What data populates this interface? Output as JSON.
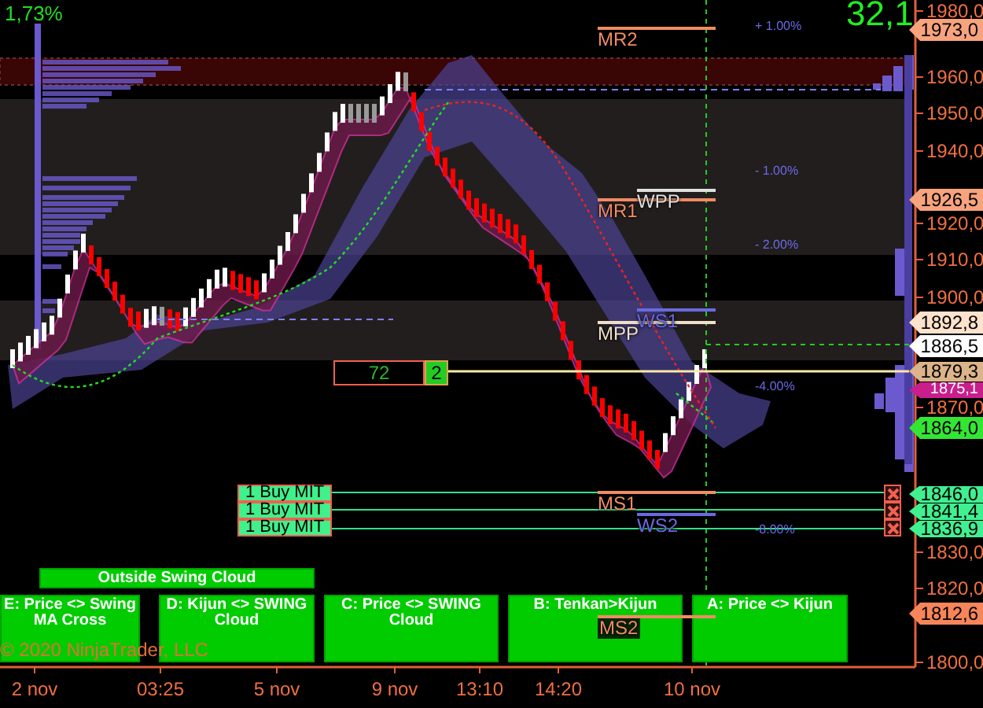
{
  "header": {
    "change_percent": "1,73%",
    "value": "32,1"
  },
  "price_axis": {
    "ticks": [
      "1980,0",
      "1960,0",
      "1950,0",
      "1940,0",
      "1920,0",
      "1910,0",
      "1900,0",
      "1870,0",
      "1830,0",
      "1820,0",
      "1800,0"
    ]
  },
  "price_markers": [
    {
      "label": "1973,0",
      "color": "#f7a37e"
    },
    {
      "label": "1926,5",
      "color": "#f7a37e"
    },
    {
      "label": "1892,8",
      "color": "#fde2cc"
    },
    {
      "label": "1886,5",
      "color": "#ffffff"
    },
    {
      "label": "1879,3",
      "color": "#dcb48a"
    },
    {
      "label": "1875,1",
      "color": "#c81f8c"
    },
    {
      "label": "1864,0",
      "color": "#33e633"
    },
    {
      "label": "1846,0",
      "color": "#40f090"
    },
    {
      "label": "1841,4",
      "color": "#40f090"
    },
    {
      "label": "1836,9",
      "color": "#40f090"
    },
    {
      "label": "1812,6",
      "color": "#f7855a"
    }
  ],
  "pivots": [
    {
      "label": "MR2",
      "color": "#f08c64"
    },
    {
      "label": "WPP",
      "color": "#e0e0e0"
    },
    {
      "label": "MR1",
      "color": "#f08c64"
    },
    {
      "label": "WS1",
      "color": "#6a6ae0"
    },
    {
      "label": "MPP",
      "color": "#f0e0c8"
    },
    {
      "label": "MS1",
      "color": "#f08c64"
    },
    {
      "label": "WS2",
      "color": "#6a6ae0"
    },
    {
      "label": "MS2",
      "color": "#f08c64"
    }
  ],
  "percent_labels": [
    "+ 1.00%",
    "- 1.00%",
    "- 2.00%",
    "-4.00%",
    "-8.00%"
  ],
  "order_box": {
    "value": "72",
    "count": "2"
  },
  "orders": [
    {
      "label": "1 Buy MIT"
    },
    {
      "label": "1 Buy MIT"
    },
    {
      "label": "1 Buy MIT"
    }
  ],
  "signals": [
    {
      "label": "Outside Swing Cloud"
    },
    {
      "label": "E: Price <> Swing MA Cross"
    },
    {
      "label": "D: Kijun <> SWING Cloud"
    },
    {
      "label": "C: Price <> SWING Cloud"
    },
    {
      "label": "B: Tenkan>Kijun"
    },
    {
      "label": "A: Price <> Kijun"
    }
  ],
  "copyright": "© 2020 NinjaTrader, LLC",
  "time_axis": {
    "labels": [
      "2 nov",
      "03:25",
      "5 nov",
      "9 nov",
      "13:10",
      "14:20",
      "10 nov"
    ]
  }
}
